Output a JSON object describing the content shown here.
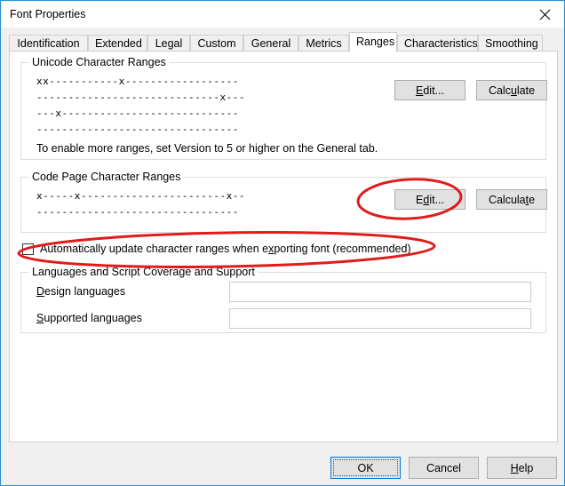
{
  "window": {
    "title": "Font Properties",
    "close_icon": "close-icon",
    "accent_color": "#2a8dd4"
  },
  "tabs": [
    {
      "label": "Identification",
      "selected": false
    },
    {
      "label": "Extended",
      "selected": false
    },
    {
      "label": "Legal",
      "selected": false
    },
    {
      "label": "Custom",
      "selected": false
    },
    {
      "label": "General",
      "selected": false
    },
    {
      "label": "Metrics",
      "selected": false
    },
    {
      "label": "Ranges",
      "selected": true
    },
    {
      "label": "Characteristics",
      "selected": false
    },
    {
      "label": "Smoothing",
      "selected": false
    }
  ],
  "unicode_group": {
    "title": "Unicode Character Ranges",
    "rows": [
      "xx-----------x------------------",
      "-----------------------------x---",
      "---x----------------------------",
      "--------------------------------"
    ],
    "hint": "To enable more ranges, set Version to 5 or higher on the General tab.",
    "edit_button": "Edit...",
    "edit_button_accel": "E",
    "calculate_button": "Calculate",
    "calculate_button_accel": "u"
  },
  "codepage_group": {
    "title": "Code Page Character Ranges",
    "rows": [
      "x-----x-----------------------x--",
      "--------------------------------"
    ],
    "edit_button": "Edit...",
    "edit_button_accel": "d",
    "calculate_button": "Calculate",
    "calculate_button_accel": "t"
  },
  "auto_update_checkbox": {
    "label": "Automatically update character ranges when exporting font (recommended)",
    "accel": "x",
    "checked": false
  },
  "languages_group": {
    "title": "Languages and Script Coverage and Support",
    "design_label": "Design languages",
    "design_accel": "D",
    "design_value": "",
    "supported_label": "Supported languages",
    "supported_accel": "S",
    "supported_value": ""
  },
  "footer": {
    "ok": "OK",
    "cancel": "Cancel",
    "help": "Help",
    "help_accel": "H"
  },
  "annotations": {
    "color": "#e01b1b",
    "ellipse_codepage_edit": "red-ellipse-around-codepage-edit-button",
    "ellipse_checkbox": "red-ellipse-around-auto-update-checkbox"
  }
}
